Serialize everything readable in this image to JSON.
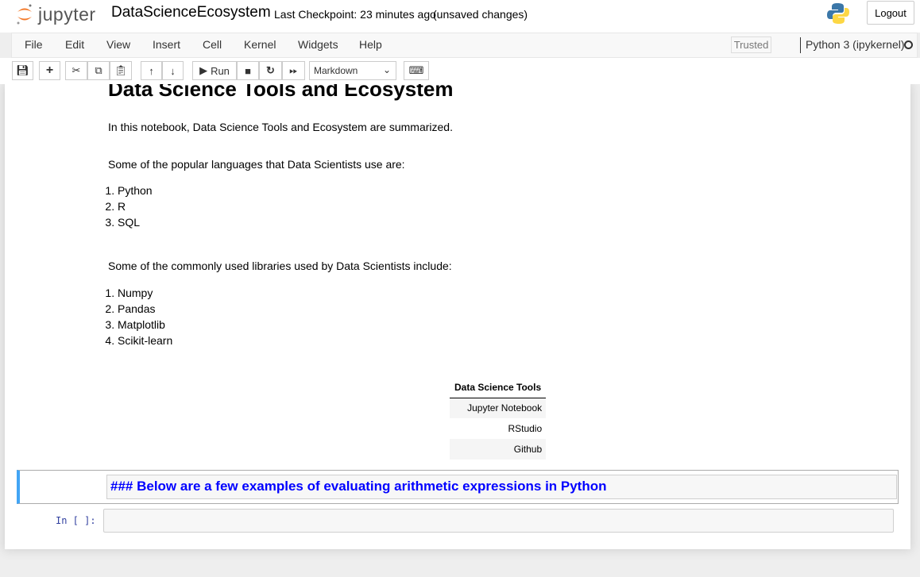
{
  "header": {
    "logo_text": "jupyter",
    "notebook_name": "DataScienceEcosystem",
    "checkpoint": "Last Checkpoint: 23 minutes ago",
    "unsaved": "(unsaved changes)",
    "logout": "Logout"
  },
  "menubar": {
    "items": [
      "File",
      "Edit",
      "View",
      "Insert",
      "Cell",
      "Kernel",
      "Widgets",
      "Help"
    ],
    "trusted": "Trusted",
    "kernel": "Python 3 (ipykernel)"
  },
  "toolbar": {
    "run": "Run",
    "cell_type": "Markdown"
  },
  "notebook": {
    "title": "Data Science Tools and Ecosystem",
    "intro": "In this notebook, Data Science Tools and Ecosystem are summarized.",
    "languages_intro": "Some of the popular languages that Data Scientists use are:",
    "languages": [
      "Python",
      "R",
      "SQL"
    ],
    "libraries_intro": "Some of the commonly used libraries used by Data Scientists include:",
    "libraries": [
      "Numpy",
      "Pandas",
      "Matplotlib",
      "Scikit-learn"
    ],
    "table": {
      "header": "Data Science Tools",
      "rows": [
        "Jupyter Notebook",
        "RStudio",
        "Github"
      ]
    },
    "markdown_source": "### Below are a few examples of evaluating arithmetic expressions in Python",
    "prompt": "In [ ]:"
  },
  "colors": {
    "accent": "#42a5f5",
    "markdown_text": "#0000ff",
    "prompt": "#303f9f"
  }
}
